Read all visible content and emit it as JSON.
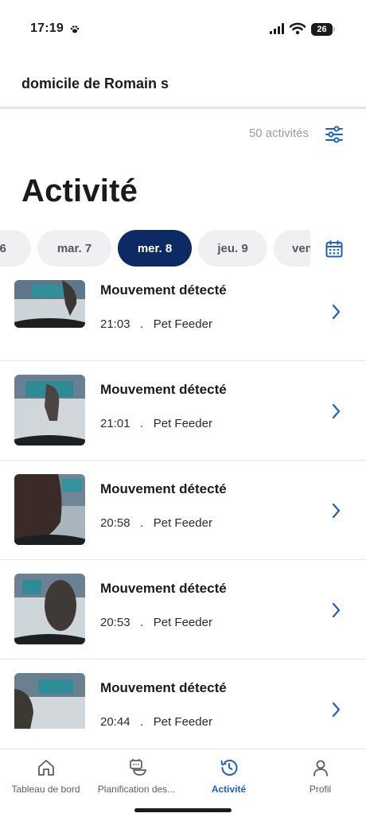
{
  "status_bar": {
    "time": "17:19",
    "battery": "26",
    "icons": [
      "paw-icon",
      "signal-icon",
      "wifi-icon",
      "battery-icon"
    ]
  },
  "header": {
    "home_name": "domicile de Romain s",
    "activity_count": "50 activités",
    "filter_icon": "sliders-icon"
  },
  "page": {
    "title": "Activité"
  },
  "days": {
    "chips": [
      {
        "label": ". 6",
        "active": false
      },
      {
        "label": "mar. 7",
        "active": false
      },
      {
        "label": "mer. 8",
        "active": true
      },
      {
        "label": "jeu. 9",
        "active": false
      },
      {
        "label": "ven",
        "active": false
      }
    ],
    "calendar_icon": "calendar-icon"
  },
  "activities": [
    {
      "title": "Mouvement détecté",
      "time": "21:03",
      "device": "Pet Feeder"
    },
    {
      "title": "Mouvement détecté",
      "time": "21:01",
      "device": "Pet Feeder"
    },
    {
      "title": "Mouvement détecté",
      "time": "20:58",
      "device": "Pet Feeder"
    },
    {
      "title": "Mouvement détecté",
      "time": "20:53",
      "device": "Pet Feeder"
    },
    {
      "title": "Mouvement détecté",
      "time": "20:44",
      "device": "Pet Feeder"
    }
  ],
  "tab_bar": {
    "tabs": [
      {
        "label": "Tableau de bord",
        "icon": "home-icon",
        "active": false
      },
      {
        "label": "Planification des...",
        "icon": "feeder-bowl-icon",
        "active": false
      },
      {
        "label": "Activité",
        "icon": "history-clock-icon",
        "active": true
      },
      {
        "label": "Profil",
        "icon": "user-icon",
        "active": false
      }
    ]
  },
  "colors": {
    "accent": "#1f5fbf",
    "active_chip": "#0c2a64",
    "chip_bg": "#f0f0f2",
    "muted_text": "#9a9aa0"
  }
}
